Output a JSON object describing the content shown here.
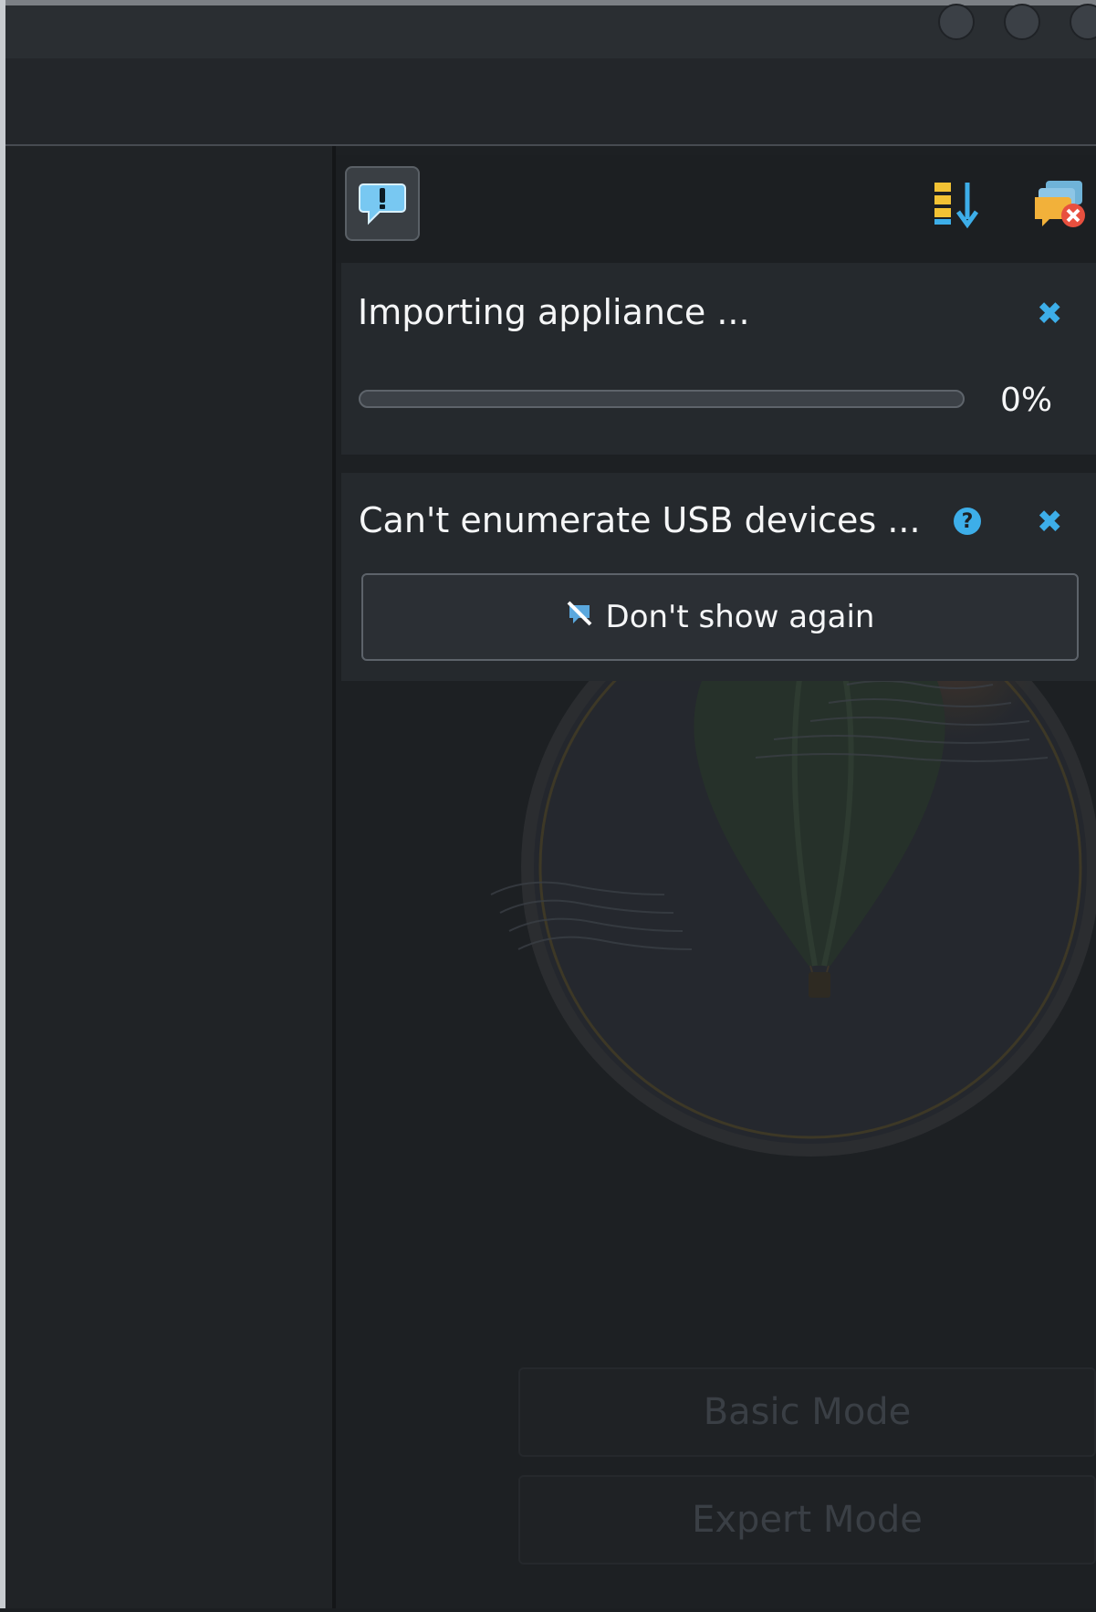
{
  "window": {
    "buttons": [
      "minimize",
      "maximize",
      "close"
    ]
  },
  "notification_center": {
    "toolbar": {
      "alert_toggle_icon": "alert-bubble-icon",
      "sort_icon": "sort-list-icon",
      "dismiss_all_icon": "dismiss-all-icon"
    },
    "notifications": [
      {
        "title": "Importing appliance ...",
        "progress_value": 0,
        "progress_text": "0%",
        "close_icon": "close-icon"
      },
      {
        "title": "Can't enumerate USB devices ...",
        "help_icon": "help-icon",
        "close_icon": "close-icon",
        "button_label": "Don't show again",
        "button_icon": "no-popup-icon"
      }
    ]
  },
  "welcome": {
    "basic_mode_label": "Basic Mode",
    "expert_mode_label": "Expert Mode"
  },
  "colors": {
    "accent": "#3daee9",
    "background": "#1b1e21",
    "card": "#25292d"
  }
}
